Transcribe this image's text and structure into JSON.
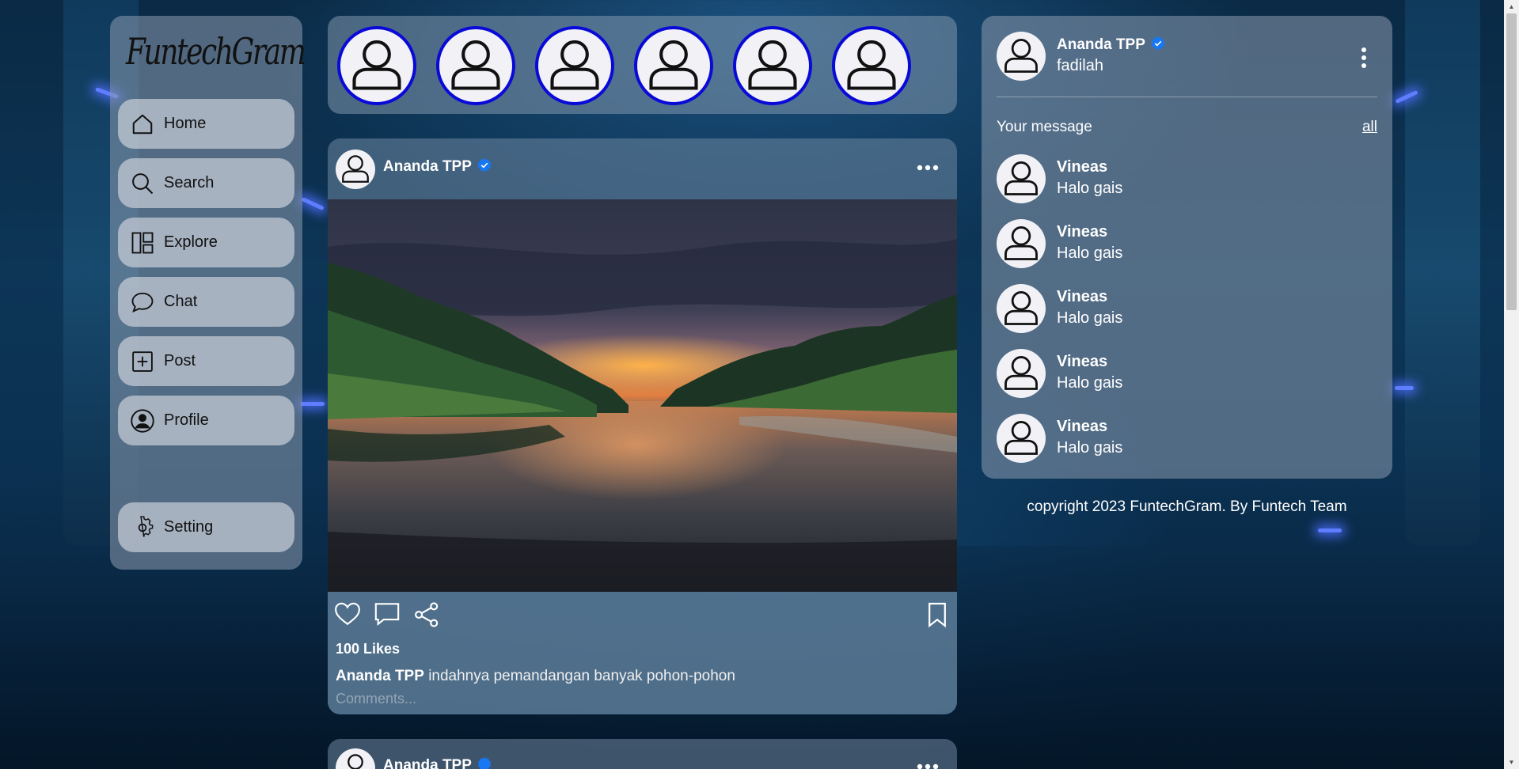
{
  "app": {
    "logo": "FuntechGram"
  },
  "sidebar": {
    "items": [
      {
        "label": "Home",
        "icon": "home-icon"
      },
      {
        "label": "Search",
        "icon": "search-icon"
      },
      {
        "label": "Explore",
        "icon": "explore-icon"
      },
      {
        "label": "Chat",
        "icon": "chat-icon"
      },
      {
        "label": "Post",
        "icon": "plus-square-icon"
      },
      {
        "label": "Profile",
        "icon": "profile-icon"
      }
    ],
    "setting": {
      "label": "Setting",
      "icon": "gear-icon"
    }
  },
  "stories": {
    "count": 6
  },
  "post": {
    "username": "Ananda TPP",
    "likes": "100 Likes",
    "caption_user": "Ananda TPP",
    "caption_text": "indahnya pemandangan banyak pohon-pohon",
    "comment_placeholder": "Comments..."
  },
  "post2": {
    "username": "Ananda TPP"
  },
  "profile": {
    "name": "Ananda TPP",
    "handle": "fadilah"
  },
  "messages": {
    "title": "Your message",
    "all_link": "all",
    "items": [
      {
        "name": "Vineas",
        "text": "Halo gais"
      },
      {
        "name": "Vineas",
        "text": "Halo gais"
      },
      {
        "name": "Vineas",
        "text": "Halo gais"
      },
      {
        "name": "Vineas",
        "text": "Halo gais"
      },
      {
        "name": "Vineas",
        "text": "Halo gais"
      }
    ]
  },
  "footer": {
    "copyright": "copyright 2023 FuntechGram. By Funtech Team"
  },
  "colors": {
    "story_ring": "#0a0ad8",
    "verified": "#1877f2"
  }
}
